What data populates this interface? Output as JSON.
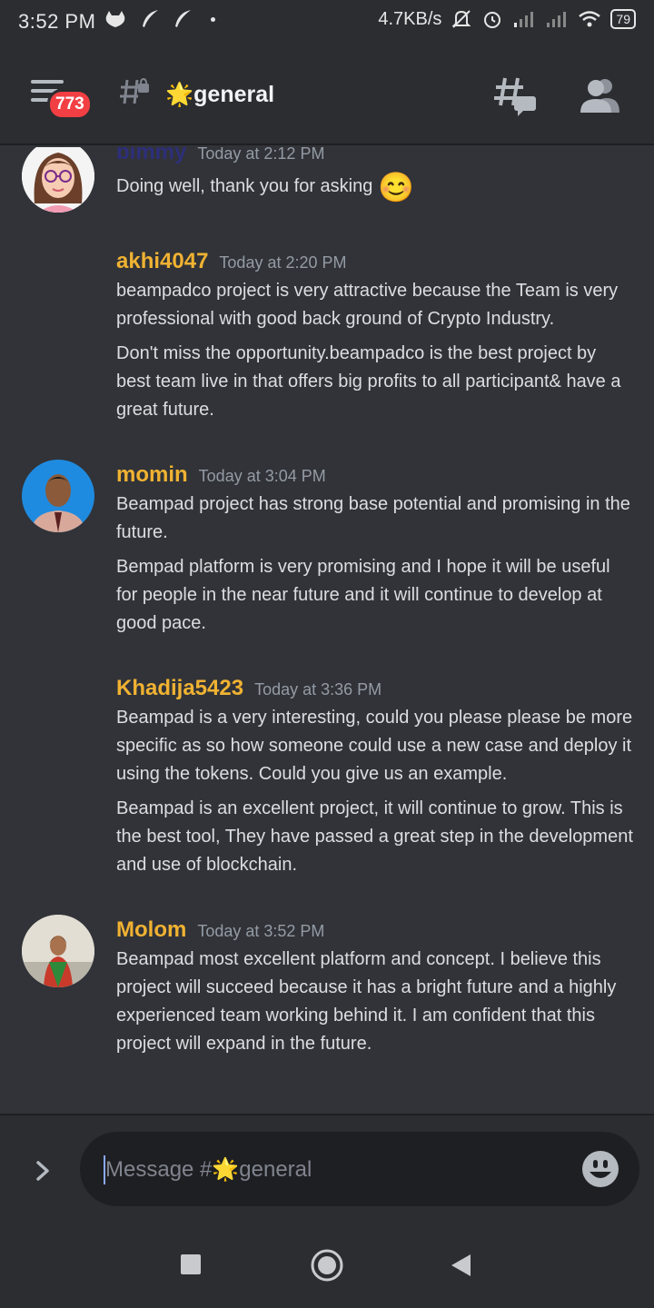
{
  "status_bar": {
    "time": "3:52 PM",
    "net_speed": "4.7KB/s",
    "battery": "79",
    "icons": [
      "cat-icon",
      "feather-icon",
      "feather-icon",
      "dot-icon",
      "mute-icon",
      "alarm-icon",
      "signal-icon",
      "signal-icon",
      "wifi-icon",
      "battery-icon"
    ]
  },
  "header": {
    "badge_count": "773",
    "channel_name": "general",
    "channel_emoji": "🌟"
  },
  "messages": [
    {
      "author": "bimmy",
      "timestamp": "Today at 2:12 PM",
      "lines": [
        "Doing well, thank you for asking"
      ],
      "emoji": "😊",
      "avatar": "cartoon-girl"
    },
    {
      "author": "akhi4047",
      "timestamp": "Today at 2:20 PM",
      "lines": [
        "beampadco project is very attractive because the Team is very professional with good back ground of Crypto Industry.",
        "Don't miss the opportunity.beampadco is the best project by best team live in that offers big profits to all participant& have a great future."
      ]
    },
    {
      "author": "momin",
      "timestamp": "Today at 3:04 PM",
      "lines": [
        "Beampad project has strong base potential and promising in the future.",
        "Bempad platform is very promising and I hope it will be useful for people in the near future and it will continue to develop at good pace."
      ],
      "avatar": "photo-man"
    },
    {
      "author": "Khadija5423",
      "timestamp": "Today at 3:36 PM",
      "lines": [
        "Beampad is a very interesting, could you please please be more specific as so how someone could use a new case and deploy it using the tokens. Could you give us an example.",
        "Beampad is an excellent project, it will continue to grow. This is the best tool, They have passed a great step in the development and use of blockchain."
      ]
    },
    {
      "author": "Molom",
      "timestamp": "Today at 3:52 PM",
      "lines": [
        "Beampad most excellent platform and concept. I believe this project will succeed because it has a bright future and a highly experienced team working behind it. I am confident that this project will expand in the future."
      ],
      "avatar": "photo-woman"
    }
  ],
  "composer": {
    "placeholder": "Message #🌟general"
  },
  "colors": {
    "background": "#313338",
    "header": "#2b2d31",
    "username": "#f0b232",
    "badge": "#f23f43",
    "input": "#1e1f22"
  }
}
